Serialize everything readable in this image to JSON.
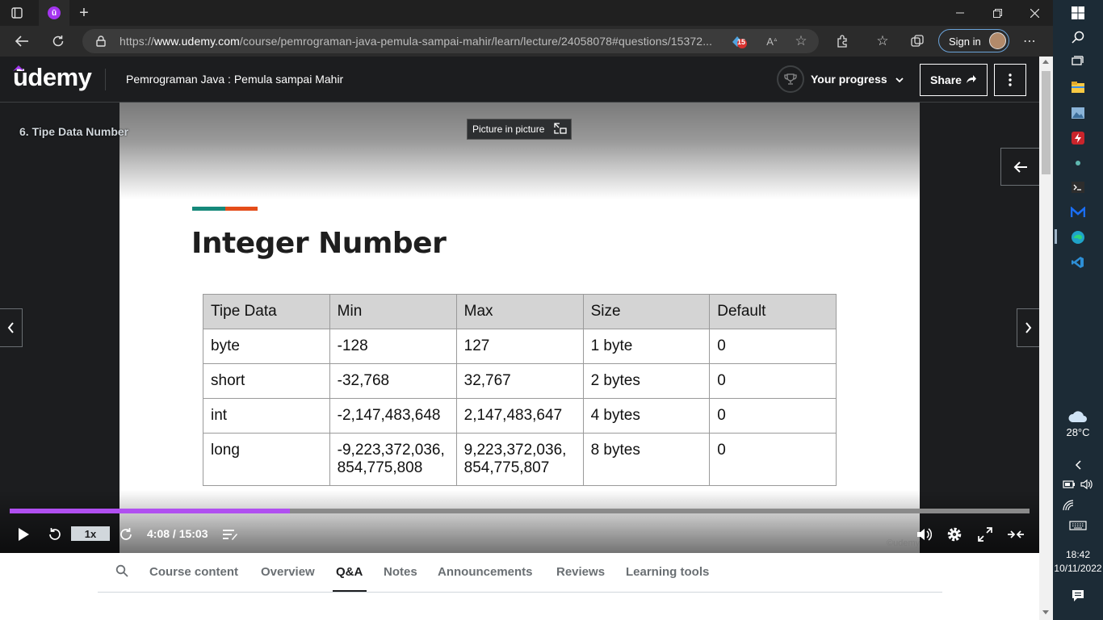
{
  "browser": {
    "url_prefix": "https://",
    "url_domain": "www.udemy.com",
    "url_path": "/course/pemrograman-java-pemula-sampai-mahir/learn/lecture/24058078#questions/15372...",
    "extension_badge": "15",
    "signin_label": "Sign in"
  },
  "header": {
    "logo": "ūdemy",
    "course_title": "Pemrograman Java : Pemula sampai Mahir",
    "progress_label": "Your progress",
    "share_label": "Share"
  },
  "video": {
    "lecture_title": "6. Tipe Data Number",
    "pip_label": "Picture in picture",
    "speed": "1x",
    "time": "4:08 / 15:03",
    "progress_fraction": 0.275,
    "watermark": "©udemy"
  },
  "slide": {
    "heading": "Integer Number",
    "table": {
      "headers": [
        "Tipe Data",
        "Min",
        "Max",
        "Size",
        "Default"
      ],
      "rows": [
        [
          "byte",
          "-128",
          "127",
          "1 byte",
          "0"
        ],
        [
          "short",
          "-32,768",
          "32,767",
          "2 bytes",
          "0"
        ],
        [
          "int",
          "-2,147,483,648",
          "2,147,483,647",
          "4 bytes",
          "0"
        ],
        [
          "long",
          "-9,223,372,036,\n854,775,808",
          "9,223,372,036,\n854,775,807",
          "8 bytes",
          "0"
        ]
      ]
    }
  },
  "tabs": [
    {
      "label": "Course content"
    },
    {
      "label": "Overview"
    },
    {
      "label": "Q&A"
    },
    {
      "label": "Notes"
    },
    {
      "label": "Announcements"
    },
    {
      "label": "Reviews"
    },
    {
      "label": "Learning tools"
    }
  ],
  "taskbar": {
    "temperature": "28°C",
    "time": "18:42",
    "date": "10/11/2022"
  },
  "colors": {
    "udemy_purple": "#a435f0",
    "progress_purple": "#b04ff0",
    "accent_teal": "#16897a",
    "accent_orange": "#e44d1a"
  }
}
